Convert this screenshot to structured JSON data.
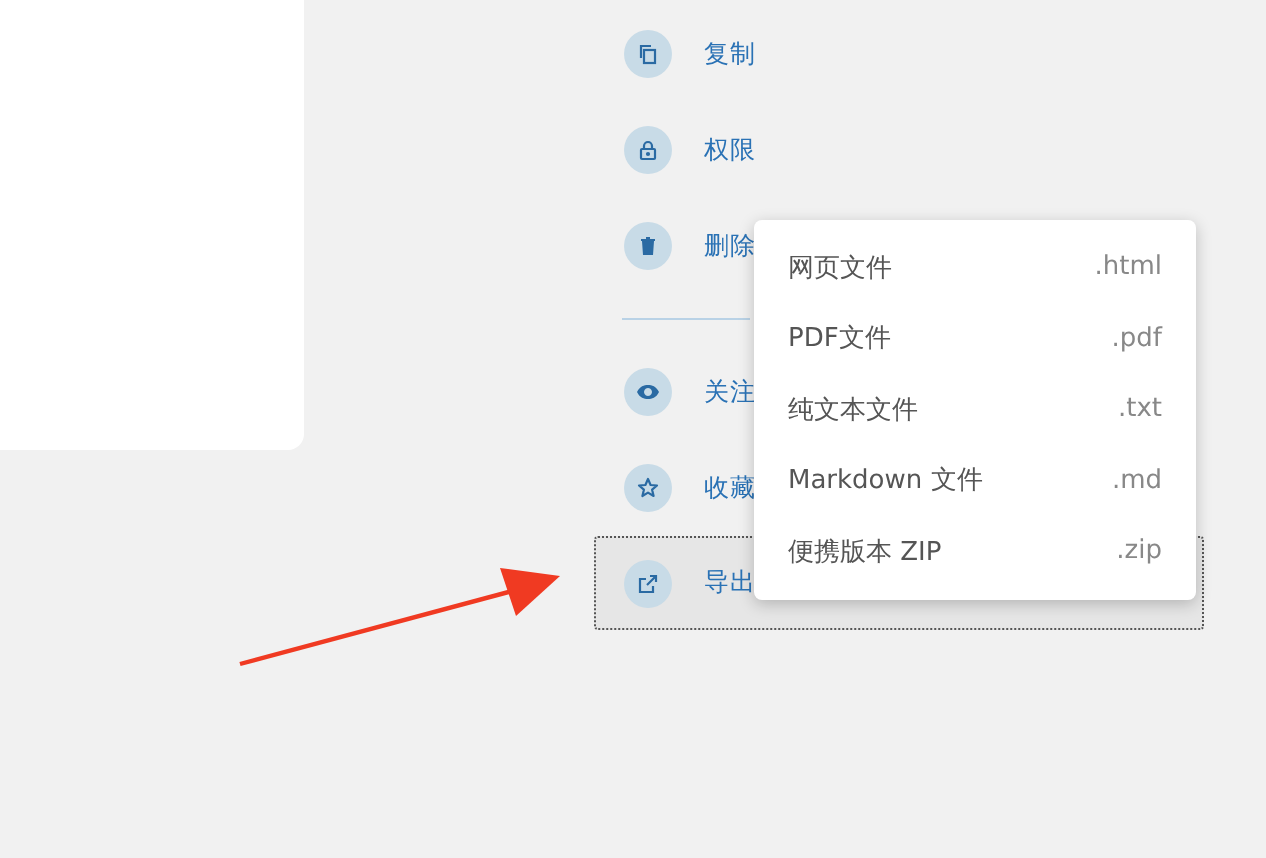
{
  "action_groups": [
    {
      "items": [
        {
          "label": "复制",
          "focused": false
        },
        {
          "label": "权限",
          "focused": false
        },
        {
          "label": "删除",
          "focused": false
        }
      ]
    },
    {
      "items": [
        {
          "label": "关注",
          "focused": false
        },
        {
          "label": "收藏",
          "focused": false
        },
        {
          "label": "导出",
          "focused": true
        }
      ]
    }
  ],
  "export_menu": {
    "items": [
      {
        "label": "网页文件",
        "extension": ".html"
      },
      {
        "label": "PDF文件",
        "extension": ".pdf"
      },
      {
        "label": "纯文本文件",
        "extension": ".txt"
      },
      {
        "label": "Markdown 文件",
        "extension": ".md"
      },
      {
        "label": "便携版本 ZIP",
        "extension": ".zip"
      }
    ]
  }
}
